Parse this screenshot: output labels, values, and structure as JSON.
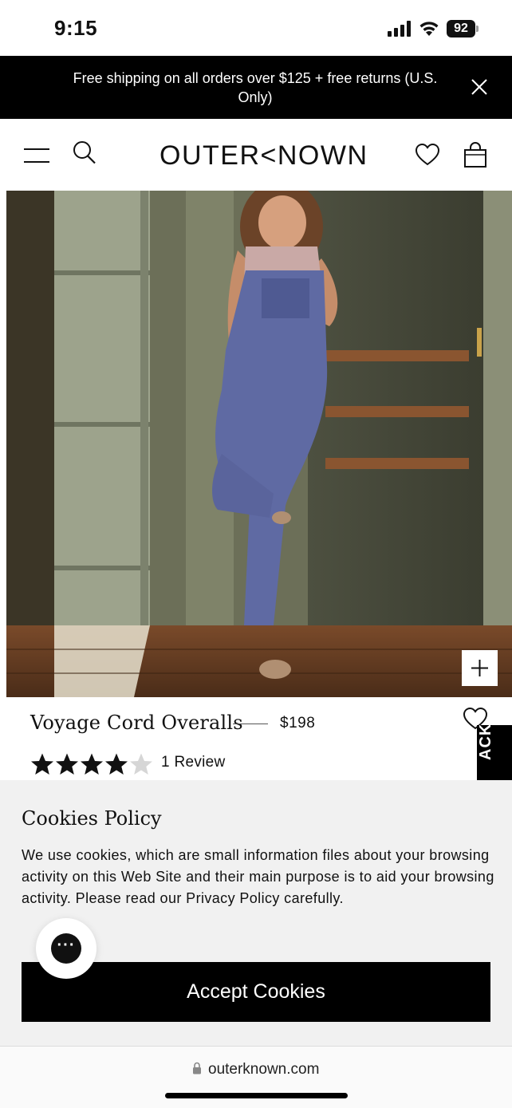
{
  "status_bar": {
    "time": "9:15",
    "battery": "92",
    "icons": [
      "signal-icon",
      "wifi-icon",
      "battery-icon"
    ]
  },
  "promo": {
    "text": "Free shipping on all orders over $125 + free returns (U.S. Only)",
    "close_icon": "close-icon"
  },
  "header": {
    "logo": "OUTER<NOWN",
    "icons": [
      "menu-icon",
      "search-icon",
      "heart-icon",
      "shopping-bag-icon"
    ]
  },
  "product": {
    "name": "Voyage Cord Overalls",
    "price": "$198",
    "rating": 4,
    "rating_max": 5,
    "review_count_label": "1 Review",
    "zoom_icon": "plus-icon",
    "wishlist_icon": "heart-icon"
  },
  "feedback_tab": {
    "label": "ACK"
  },
  "cookies": {
    "title": "Cookies Policy",
    "body": "We use cookies, which are small information files about your browsing activity on this Web Site and their main purpose is to aid your browsing activity. Please read our Privacy Policy carefully.",
    "accept_label": "Accept Cookies"
  },
  "chat": {
    "icon": "chat-bubble-icon"
  },
  "browser": {
    "url": "outerknown.com",
    "lock_icon": "lock-icon"
  },
  "colors": {
    "banner_bg": "#000000",
    "cookie_bg": "#f1f1f1",
    "button_bg": "#000000",
    "text": "#111111"
  }
}
